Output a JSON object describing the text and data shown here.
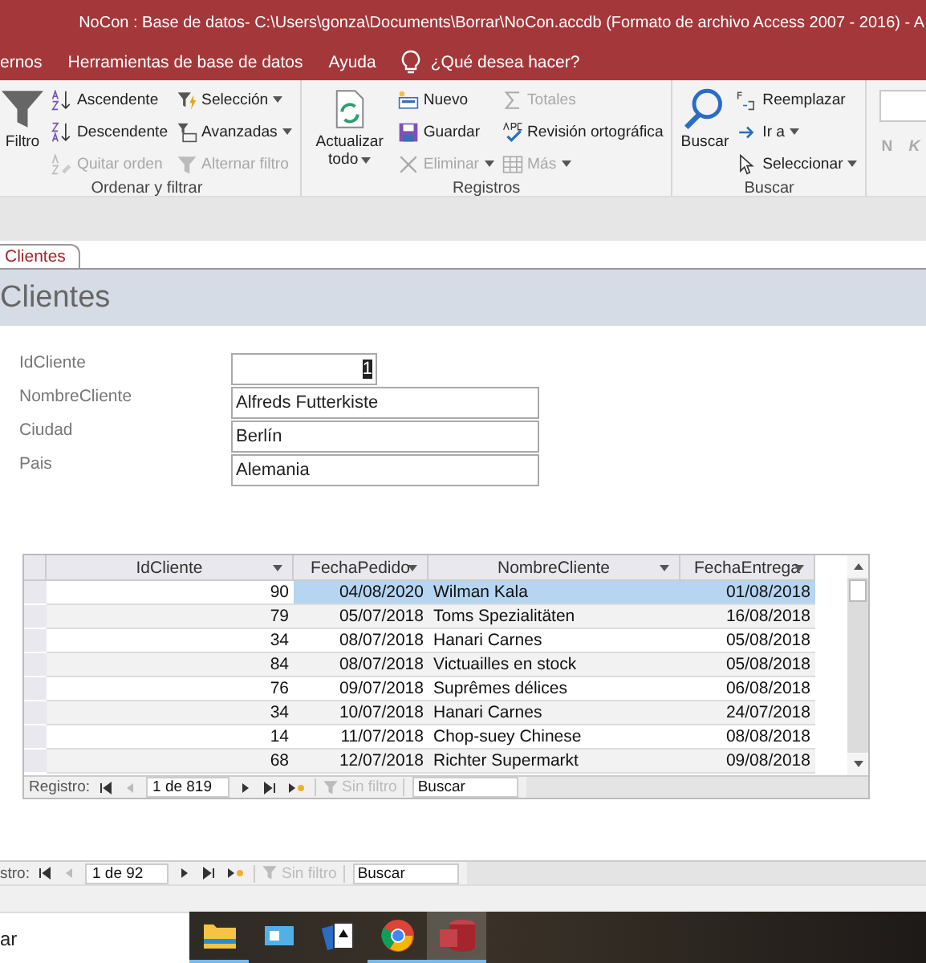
{
  "window": {
    "title": "NoCon : Base de datos- C:\\Users\\gonza\\Documents\\Borrar\\NoCon.accdb (Formato de archivo Access 2007 - 2016)  -  A"
  },
  "menu": {
    "tabs": [
      {
        "label": "ernos",
        "selected": false
      },
      {
        "label": "Herramientas de base de datos",
        "selected": false
      },
      {
        "label": "Ayuda",
        "selected": false
      }
    ],
    "tell_me": "¿Qué desea hacer?"
  },
  "ribbon": {
    "groups": [
      {
        "label": "Ordenar y filtrar",
        "items": [
          {
            "kind": "large",
            "label": "Filtro",
            "disabled": false,
            "dropdown": false
          },
          {
            "kind": "small",
            "label": "Ascendente",
            "disabled": false,
            "dropdown": false
          },
          {
            "kind": "small",
            "label": "Descendente",
            "disabled": false,
            "dropdown": false
          },
          {
            "kind": "small",
            "label": "Quitar orden",
            "disabled": true,
            "dropdown": false
          },
          {
            "kind": "small",
            "label": "Selección",
            "disabled": false,
            "dropdown": true
          },
          {
            "kind": "small",
            "label": "Avanzadas",
            "disabled": false,
            "dropdown": true
          },
          {
            "kind": "small",
            "label": "Alternar filtro",
            "disabled": true,
            "dropdown": false
          }
        ]
      },
      {
        "label": "Registros",
        "items": [
          {
            "kind": "large",
            "label": "Actualizar todo",
            "disabled": false,
            "dropdown": true
          },
          {
            "kind": "small",
            "label": "Nuevo",
            "disabled": false,
            "dropdown": false
          },
          {
            "kind": "small",
            "label": "Guardar",
            "disabled": false,
            "dropdown": false
          },
          {
            "kind": "small",
            "label": "Eliminar",
            "disabled": true,
            "dropdown": true
          },
          {
            "kind": "small",
            "label": "Totales",
            "disabled": true,
            "dropdown": false
          },
          {
            "kind": "small",
            "label": "Revisión ortográfica",
            "disabled": false,
            "dropdown": false
          },
          {
            "kind": "small",
            "label": "Más",
            "disabled": true,
            "dropdown": true
          }
        ]
      },
      {
        "label": "Buscar",
        "items": [
          {
            "kind": "large",
            "label": "Buscar",
            "disabled": false,
            "dropdown": false
          },
          {
            "kind": "small",
            "label": "Reemplazar",
            "disabled": false,
            "dropdown": false
          },
          {
            "kind": "small",
            "label": "Ir a",
            "disabled": false,
            "dropdown": true
          },
          {
            "kind": "small",
            "label": "Seleccionar",
            "disabled": false,
            "dropdown": true
          }
        ]
      },
      {
        "items": [
          {
            "kind": "combo"
          },
          {
            "kind": "format",
            "label": "N",
            "disabled": true
          },
          {
            "kind": "format",
            "label": "K",
            "disabled": true
          }
        ]
      }
    ]
  },
  "form": {
    "tab": {
      "label": "Clientes",
      "selected": true
    },
    "title": "Clientes",
    "fields": [
      {
        "label": "IdCliente",
        "value": "1",
        "kind": "number",
        "focused": true
      },
      {
        "label": "NombreCliente",
        "value": "Alfreds Futterkiste",
        "kind": "text",
        "focused": false
      },
      {
        "label": "Ciudad",
        "value": "Berlín",
        "kind": "text",
        "focused": false
      },
      {
        "label": "Pais",
        "value": "Alemania",
        "kind": "text",
        "focused": false
      }
    ],
    "subform": {
      "columns": [
        {
          "label": "IdCliente",
          "kind": "number"
        },
        {
          "label": "FechaPedido",
          "kind": "date"
        },
        {
          "label": "NombreCliente",
          "kind": "text"
        },
        {
          "label": "FechaEntrega",
          "kind": "date"
        }
      ],
      "rows": [
        {
          "cells": [
            "90",
            "04/08/2020",
            "Wilman Kala",
            "01/08/2018"
          ],
          "selected": true
        },
        {
          "cells": [
            "79",
            "05/07/2018",
            "Toms Spezialitäten",
            "16/08/2018"
          ],
          "selected": false
        },
        {
          "cells": [
            "34",
            "08/07/2018",
            "Hanari Carnes",
            "05/08/2018"
          ],
          "selected": false
        },
        {
          "cells": [
            "84",
            "08/07/2018",
            "Victuailles en stock",
            "05/08/2018"
          ],
          "selected": false
        },
        {
          "cells": [
            "76",
            "09/07/2018",
            "Suprêmes délices",
            "06/08/2018"
          ],
          "selected": false
        },
        {
          "cells": [
            "34",
            "10/07/2018",
            "Hanari Carnes",
            "24/07/2018"
          ],
          "selected": false
        },
        {
          "cells": [
            "14",
            "11/07/2018",
            "Chop-suey Chinese",
            "08/08/2018"
          ],
          "selected": false
        },
        {
          "cells": [
            "68",
            "12/07/2018",
            "Richter Supermarkt",
            "09/08/2018"
          ],
          "selected": false
        }
      ],
      "nav": {
        "label": "Registro:",
        "before": [
          {
            "kind": "first",
            "disabled": false
          },
          {
            "kind": "prev",
            "disabled": true
          }
        ],
        "record": "1 de 819",
        "after": [
          {
            "kind": "next",
            "disabled": false
          },
          {
            "kind": "last",
            "disabled": false
          },
          {
            "kind": "new",
            "disabled": false
          }
        ],
        "filter": {
          "label": "Sin filtro",
          "disabled": true
        },
        "search": {
          "placeholder": "Buscar"
        }
      }
    }
  },
  "nav": {
    "label": "stro:",
    "before": [
      {
        "kind": "first",
        "disabled": false
      },
      {
        "kind": "prev",
        "disabled": true
      }
    ],
    "record": "1 de 92",
    "after": [
      {
        "kind": "next",
        "disabled": false
      },
      {
        "kind": "last",
        "disabled": false
      },
      {
        "kind": "new",
        "disabled": false
      }
    ],
    "filter": {
      "label": "Sin filtro",
      "disabled": true
    },
    "search": {
      "placeholder": "Buscar"
    }
  },
  "taskbar": {
    "search_text": "ar",
    "apps": [
      {
        "kind": "explorer",
        "running": true,
        "selected": false
      },
      {
        "kind": "display",
        "running": false,
        "selected": false
      },
      {
        "kind": "cards",
        "running": false,
        "selected": false
      },
      {
        "kind": "browser",
        "running": true,
        "selected": false
      },
      {
        "kind": "database",
        "running": true,
        "selected": true
      }
    ]
  }
}
